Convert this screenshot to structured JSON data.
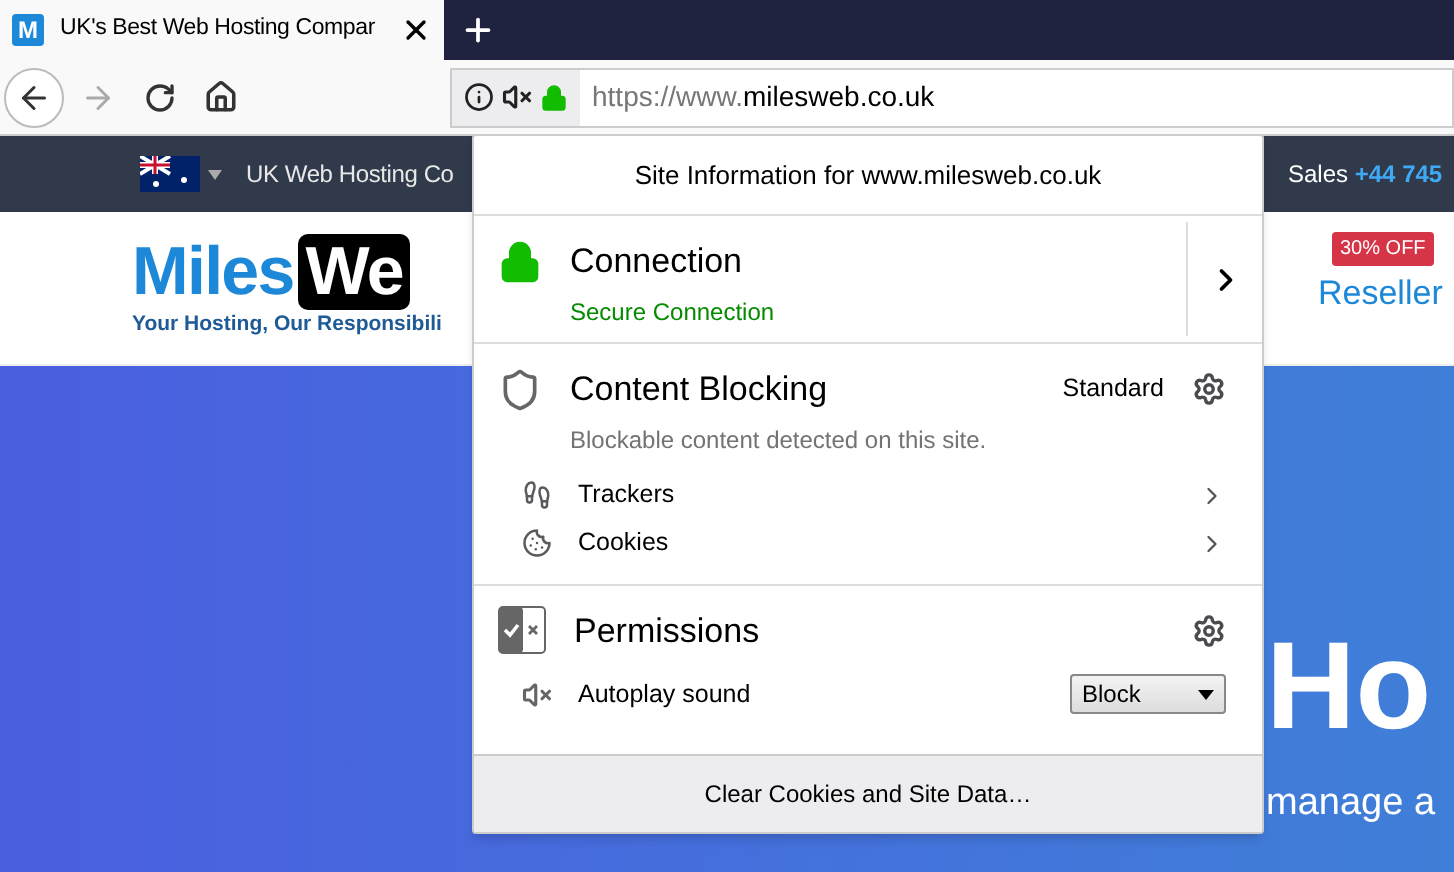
{
  "browser": {
    "tab": {
      "title": "UK's Best Web Hosting Compar",
      "favicon": "M"
    },
    "url": {
      "prefix": "https://www.",
      "domain": "milesweb.co.uk"
    }
  },
  "site": {
    "topbar": {
      "menu": "UK Web Hosting Co",
      "sales_label": "Sales",
      "sales_phone": "+44 745"
    },
    "logo": {
      "part1": "Miles",
      "part2": "We",
      "tagline": "Your Hosting, Our Responsibili"
    },
    "offer_badge": "30% OFF",
    "reseller": "Reseller",
    "hero_title": "Ho",
    "hero_sub": "manage a"
  },
  "popup": {
    "title": "Site Information for www.milesweb.co.uk",
    "connection": {
      "heading": "Connection",
      "status": "Secure Connection",
      "secure": true
    },
    "content_blocking": {
      "heading": "Content Blocking",
      "level": "Standard",
      "note": "Blockable content detected on this site.",
      "items": [
        {
          "kind": "trackers",
          "label": "Trackers"
        },
        {
          "kind": "cookies",
          "label": "Cookies"
        }
      ]
    },
    "permissions": {
      "heading": "Permissions",
      "items": [
        {
          "label": "Autoplay sound",
          "value": "Block"
        }
      ]
    },
    "footer_button": "Clear Cookies and Site Data…"
  }
}
